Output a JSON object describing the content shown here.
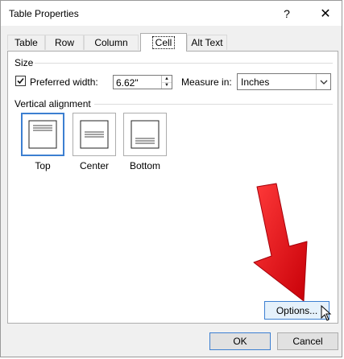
{
  "window": {
    "title": "Table Properties",
    "help_glyph": "?",
    "close_glyph": "✕"
  },
  "tabs": [
    {
      "label": "Table",
      "active": false
    },
    {
      "label": "Row",
      "active": false
    },
    {
      "label": "Column",
      "active": false
    },
    {
      "label": "Cell",
      "active": true
    },
    {
      "label": "Alt Text",
      "active": false
    }
  ],
  "size": {
    "section_label": "Size",
    "preferred_width_label": "Preferred width:",
    "preferred_width_checked": true,
    "preferred_width_value": "6.62\"",
    "measure_in_label": "Measure in:",
    "measure_in_value": "Inches"
  },
  "vertical_alignment": {
    "section_label": "Vertical alignment",
    "options": [
      {
        "label": "Top",
        "selected": true,
        "icon": "align-top-icon"
      },
      {
        "label": "Center",
        "selected": false,
        "icon": "align-center-icon"
      },
      {
        "label": "Bottom",
        "selected": false,
        "icon": "align-bottom-icon"
      }
    ]
  },
  "annotation": {
    "icon": "red-arrow-icon",
    "color": "#e8141b"
  },
  "buttons": {
    "options": "Options...",
    "ok": "OK",
    "cancel": "Cancel"
  },
  "colors": {
    "accent": "#3c7fd1",
    "arrow": "#e8141b"
  }
}
